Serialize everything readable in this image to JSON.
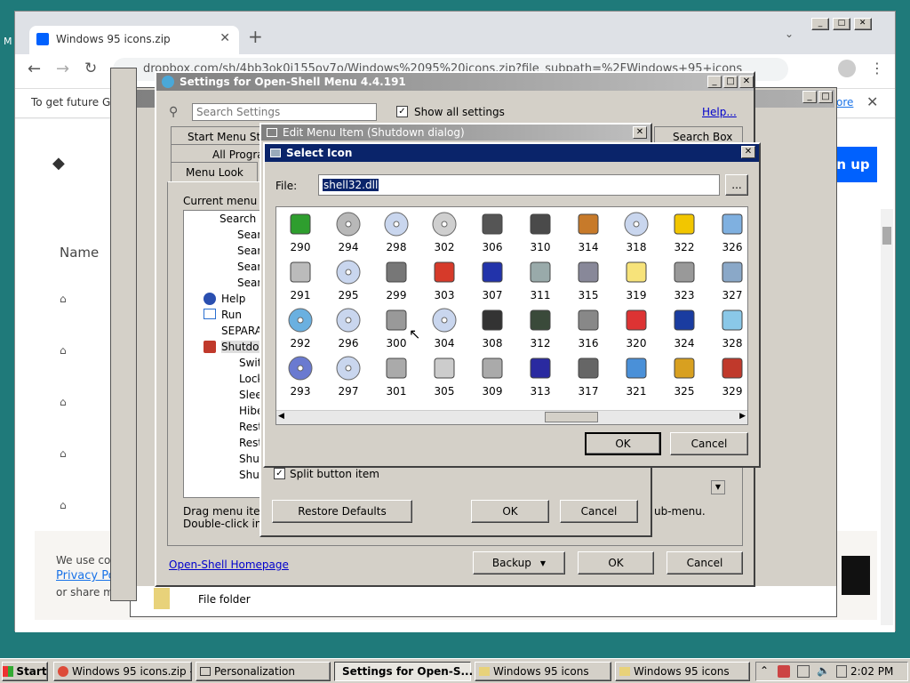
{
  "desktop_label": "M",
  "chrome": {
    "tab_title": "Windows 95 icons.zip",
    "url": "dropbox.com/sh/4bb3ok0i155ov7o/Windows%2095%20icons.zip?file_subpath=%2FWindows+95+icons",
    "info_bar": "To get future Go",
    "info_more": "ore",
    "sign_up": "n up",
    "name_header": "Name",
    "cookie_text1": "We use co",
    "cookie_link": "Privacy Po",
    "cookie_text2": "or share m",
    "file_folder": "File folder"
  },
  "settings": {
    "title": "Settings for Open-Shell Menu 4.4.191",
    "search_placeholder": "Search Settings",
    "show_all_label": "Show all settings",
    "help_link": "Help...",
    "tabs": [
      "Start Menu Styl",
      "All Progra",
      "Menu Look",
      "Search Box"
    ],
    "current_menu_label": "Current menu ite",
    "tree": [
      "Search m",
      "Sear",
      "Sear",
      "Sear",
      "Sear",
      "Help",
      "Run",
      "SEPARA",
      "Shutdov",
      "Swit",
      "Lock",
      "Slee",
      "Hibe",
      "Rest",
      "Rest",
      "Shut",
      "Shut"
    ],
    "drag_text": "Drag menu item",
    "dbl_text": "Double-click in t",
    "homepage": "Open-Shell Homepage",
    "backup": "Backup",
    "ok": "OK",
    "cancel": "Cancel",
    "submenu_text": "ub-menu."
  },
  "edit_item": {
    "title": "Edit Menu Item (Shutdown dialog)",
    "split_label": "Split button item",
    "restore": "Restore Defaults",
    "ok": "OK",
    "cancel": "Cancel"
  },
  "select_icon": {
    "title": "Select Icon",
    "file_label": "File:",
    "file_value": "shell32.dll",
    "browse": "...",
    "ok": "OK",
    "cancel": "Cancel",
    "icons": [
      {
        "num": "290",
        "type": "arrow-green"
      },
      {
        "num": "294",
        "type": "cdrom"
      },
      {
        "num": "298",
        "type": "dvdr"
      },
      {
        "num": "302",
        "type": "disc"
      },
      {
        "num": "306",
        "type": "phone"
      },
      {
        "num": "310",
        "type": "cellphone"
      },
      {
        "num": "314",
        "type": "pda"
      },
      {
        "num": "318",
        "type": "dvdrw"
      },
      {
        "num": "322",
        "type": "star"
      },
      {
        "num": "326",
        "type": "calendar"
      },
      {
        "num": "291",
        "type": "dvd-drive"
      },
      {
        "num": "295",
        "type": "cdr"
      },
      {
        "num": "299",
        "type": "scanner"
      },
      {
        "num": "303",
        "type": "book-red"
      },
      {
        "num": "307",
        "type": "memcard"
      },
      {
        "num": "311",
        "type": "printer"
      },
      {
        "num": "315",
        "type": "scanner-flat"
      },
      {
        "num": "319",
        "type": "note"
      },
      {
        "num": "323",
        "type": "magnifier"
      },
      {
        "num": "327",
        "type": "network-pc"
      },
      {
        "num": "292",
        "type": "disc-plus"
      },
      {
        "num": "296",
        "type": "cdrw"
      },
      {
        "num": "300",
        "type": "hdd"
      },
      {
        "num": "304",
        "type": "dvdrom"
      },
      {
        "num": "308",
        "type": "memcard2"
      },
      {
        "num": "312",
        "type": "usb"
      },
      {
        "num": "316",
        "type": "camera"
      },
      {
        "num": "320",
        "type": "dial"
      },
      {
        "num": "324",
        "type": "help"
      },
      {
        "num": "328",
        "type": "screen"
      },
      {
        "num": "293",
        "type": "help-disc"
      },
      {
        "num": "297",
        "type": "dvdram"
      },
      {
        "num": "301",
        "type": "hdd2"
      },
      {
        "num": "305",
        "type": "drive-flat"
      },
      {
        "num": "309",
        "type": "camera2"
      },
      {
        "num": "313",
        "type": "floppy"
      },
      {
        "num": "317",
        "type": "camcorder"
      },
      {
        "num": "321",
        "type": "control-panel"
      },
      {
        "num": "325",
        "type": "key"
      },
      {
        "num": "329",
        "type": "power"
      }
    ]
  },
  "taskbar": {
    "start": "Start",
    "items": [
      "Windows 95 icons.zip - ...",
      "Personalization",
      "Settings for Open-S...",
      "Windows 95 icons",
      "Windows 95 icons"
    ],
    "clock": "2:02 PM"
  }
}
